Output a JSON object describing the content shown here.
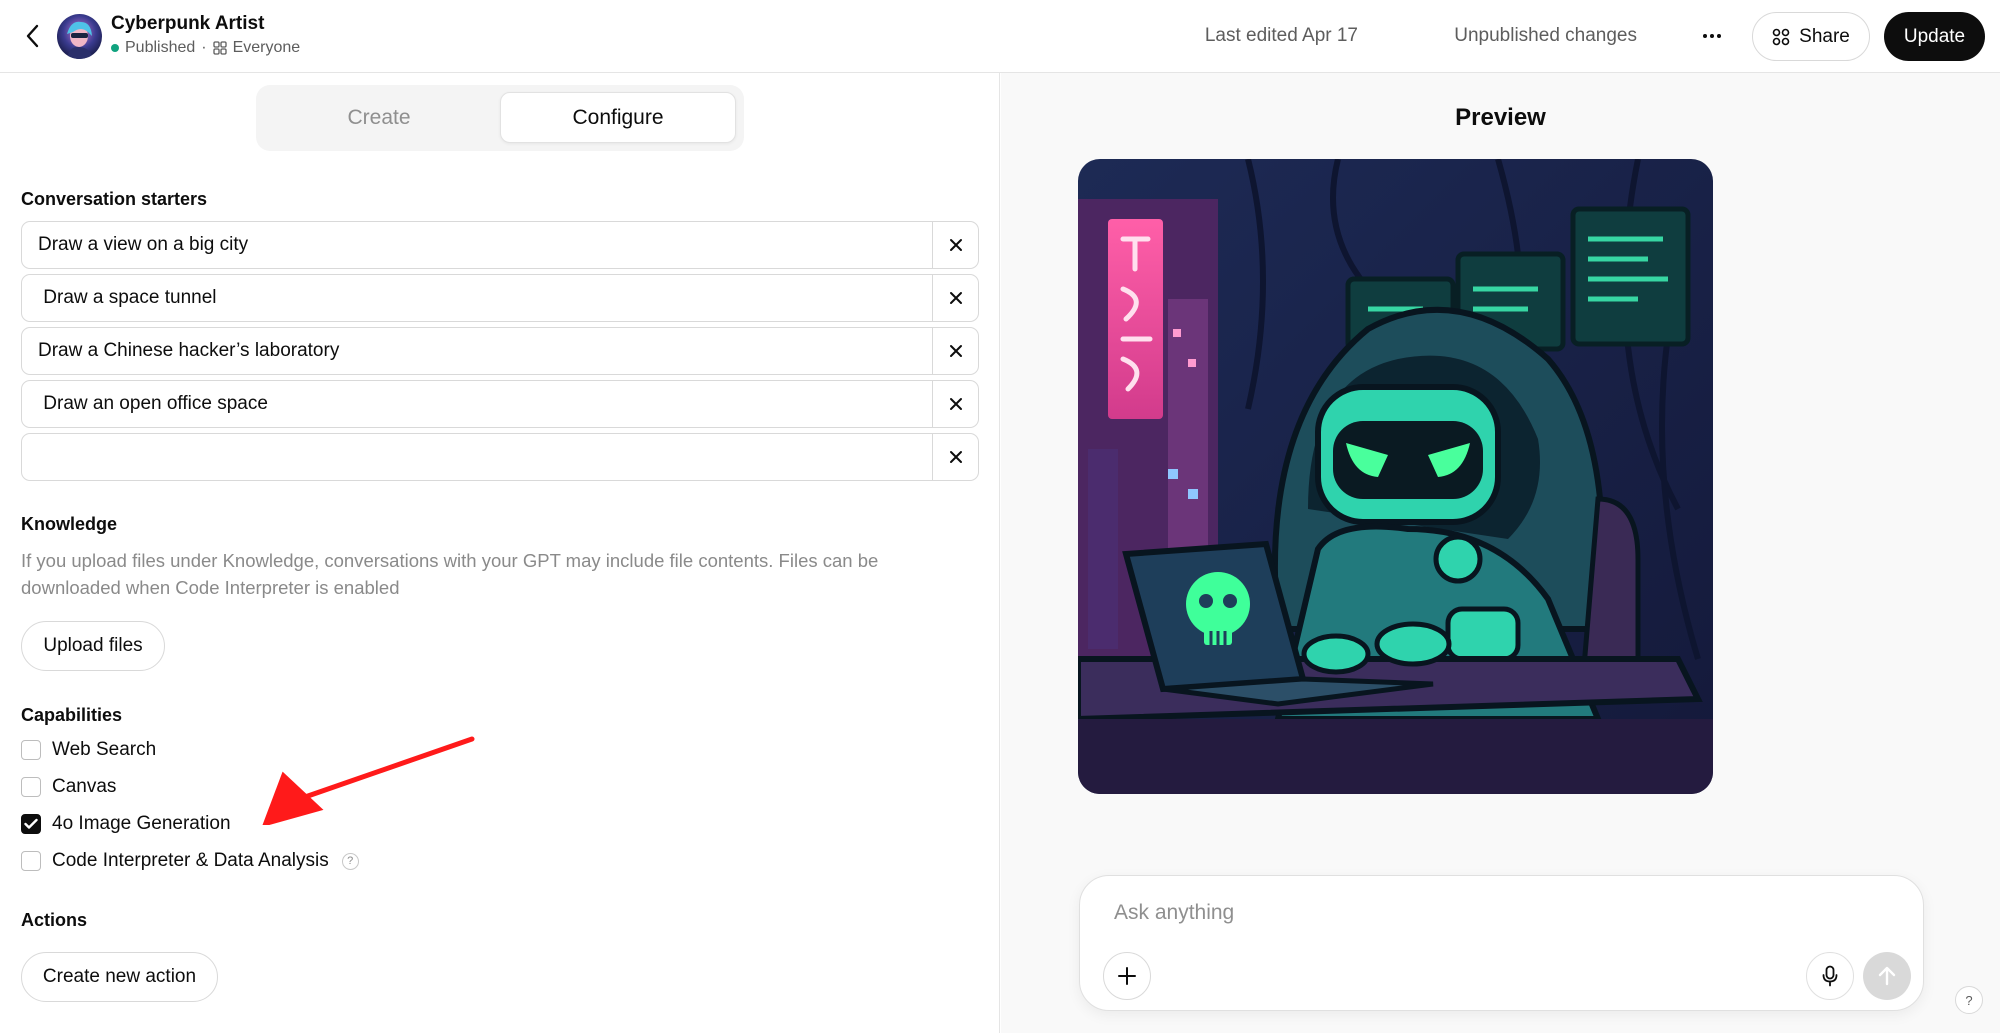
{
  "header": {
    "gpt_name": "Cyberpunk Artist",
    "status": "Published",
    "separator": "·",
    "audience": "Everyone",
    "last_edited": "Last edited Apr 17",
    "unpublished": "Unpublished changes",
    "more_label": "···",
    "share_label": "Share",
    "update_label": "Update"
  },
  "tabs": [
    {
      "label": "Create",
      "active": false
    },
    {
      "label": "Configure",
      "active": true
    }
  ],
  "conversation_starters": {
    "label": "Conversation starters",
    "items": [
      {
        "value": "Draw a view on a big city"
      },
      {
        "value": " Draw a space tunnel"
      },
      {
        "value": "Draw a Chinese hacker’s laboratory"
      },
      {
        "value": " Draw an open office space"
      },
      {
        "value": ""
      }
    ]
  },
  "knowledge": {
    "label": "Knowledge",
    "description": "If you upload files under Knowledge, conversations with your GPT may include file contents. Files can be downloaded when Code Interpreter is enabled",
    "upload_label": "Upload files"
  },
  "capabilities": {
    "label": "Capabilities",
    "items": [
      {
        "label": "Web Search",
        "checked": false
      },
      {
        "label": "Canvas",
        "checked": false
      },
      {
        "label": "4o Image Generation",
        "checked": true
      },
      {
        "label": "Code Interpreter & Data Analysis",
        "checked": false,
        "help": "?"
      }
    ]
  },
  "actions": {
    "label": "Actions",
    "create_label": "Create new action"
  },
  "preview": {
    "title": "Preview",
    "composer_placeholder": "Ask anything",
    "help": "?"
  },
  "colors": {
    "published_dot": "#10a37f",
    "annotation_arrow": "#ff1a1a",
    "primary_button": "#0d0d0d"
  },
  "icons": [
    "chevron-left-icon",
    "people-icon",
    "share-grid-icon",
    "close-icon",
    "checkmark-icon",
    "plus-icon",
    "microphone-icon",
    "arrow-up-icon",
    "question-icon"
  ]
}
